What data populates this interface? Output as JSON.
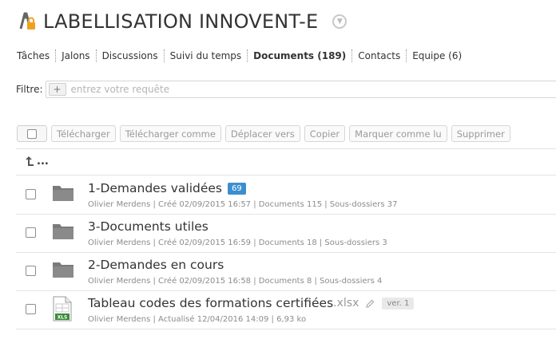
{
  "header": {
    "title": "LABELLISATION INNOVENT-E",
    "project_icon": "project-lock-icon",
    "dropdown_icon": "chevron-down-icon"
  },
  "tabs": [
    {
      "label": "Tâches",
      "active": false
    },
    {
      "label": "Jalons",
      "active": false
    },
    {
      "label": "Discussions",
      "active": false
    },
    {
      "label": "Suivi du temps",
      "active": false
    },
    {
      "label": "Documents (189)",
      "active": true
    },
    {
      "label": "Contacts",
      "active": false
    },
    {
      "label": "Equipe (6)",
      "active": false
    }
  ],
  "filter": {
    "label": "Filtre:",
    "add_symbol": "+",
    "placeholder": "entrez votre requête",
    "value": ""
  },
  "toolbar": {
    "buttons": [
      "Télécharger",
      "Télécharger comme",
      "Déplacer vers",
      "Copier",
      "Marquer comme lu",
      "Supprimer"
    ]
  },
  "parent": {
    "label": "...",
    "icon": "up-arrow-icon"
  },
  "items": [
    {
      "type": "folder",
      "name": "1-Demandes validées",
      "badge": "69",
      "meta": "Olivier Merdens | Créé 02/09/2015 16:57 | Documents 115 | Sous-dossiers 37"
    },
    {
      "type": "folder",
      "name": "3-Documents utiles",
      "meta": "Olivier Merdens | Créé 02/09/2015 16:59 | Documents 18 | Sous-dossiers 3"
    },
    {
      "type": "folder",
      "name": "2-Demandes en cours",
      "meta": "Olivier Merdens | Créé 02/09/2015 16:58 | Documents 8 | Sous-dossiers 4"
    },
    {
      "type": "file",
      "name": "Tableau codes des formations certifiées",
      "ext": ".xlsx",
      "version": "ver. 1",
      "file_icon_label": "XLS",
      "meta": "Olivier Merdens | Actualisé 12/04/2016 14:09 | 6,93 ko"
    }
  ],
  "colors": {
    "badge": "#3b8fd0",
    "folder": "#7a7a7a",
    "excel": "#3a8a3a",
    "accent_orange": "#f0a020"
  }
}
